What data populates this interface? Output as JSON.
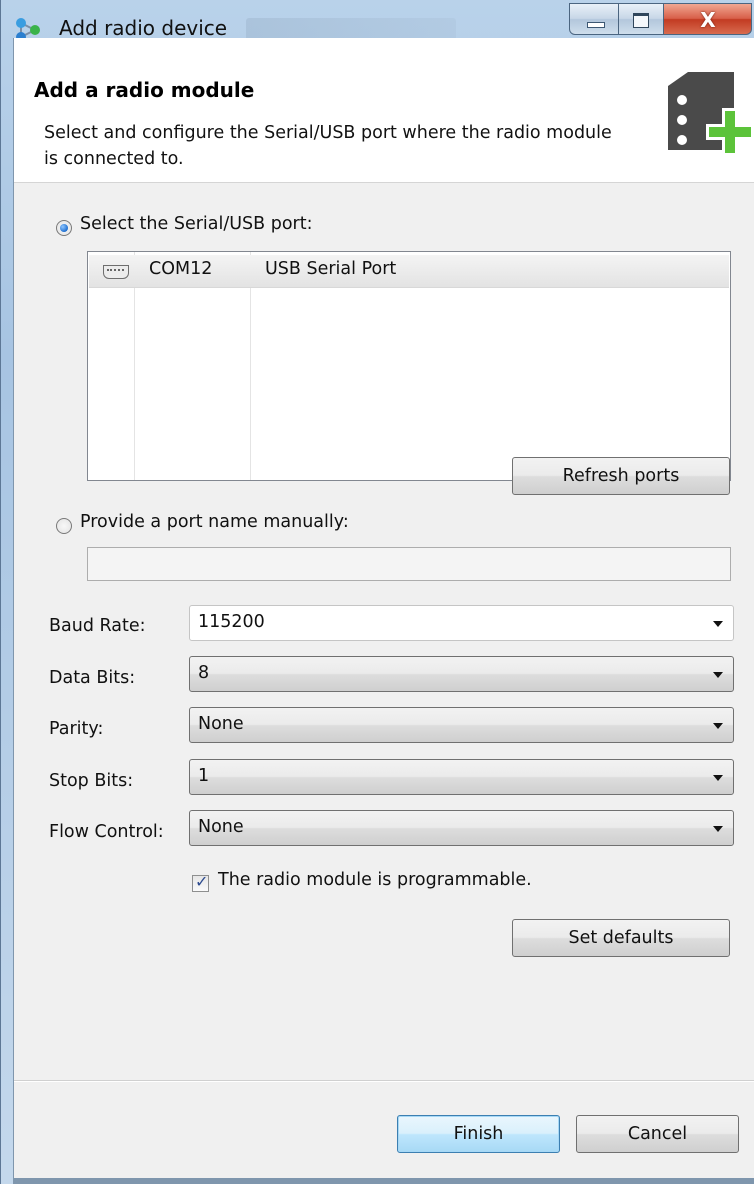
{
  "window": {
    "title": "Add radio device",
    "controls": {
      "minimize": "minimize",
      "maximize": "maximize",
      "close": "X"
    }
  },
  "header": {
    "title": "Add a radio module",
    "description": "Select and configure the Serial/USB port where the radio module is connected to.",
    "icon": "radio-module-add-icon"
  },
  "port_selection": {
    "select_label": "Select the Serial/USB port:",
    "select_checked": true,
    "ports": [
      {
        "icon": "serial-port-icon",
        "name": "COM12",
        "description": "USB Serial Port"
      }
    ],
    "refresh_label": "Refresh ports",
    "manual_label": "Provide a port name manually:",
    "manual_checked": false,
    "manual_value": ""
  },
  "settings": {
    "baud_rate": {
      "label": "Baud Rate:",
      "value": "115200"
    },
    "data_bits": {
      "label": "Data Bits:",
      "value": "8"
    },
    "parity": {
      "label": "Parity:",
      "value": "None"
    },
    "stop_bits": {
      "label": "Stop Bits:",
      "value": "1"
    },
    "flow_control": {
      "label": "Flow Control:",
      "value": "None"
    },
    "programmable": {
      "label": "The radio module is programmable.",
      "checked": true
    },
    "set_defaults_label": "Set defaults"
  },
  "footer": {
    "finish_label": "Finish",
    "cancel_label": "Cancel"
  },
  "colors": {
    "plus_green": "#5cc33a",
    "module_dark": "#4a4a4a",
    "accent_blue": "#3c7fb1"
  }
}
